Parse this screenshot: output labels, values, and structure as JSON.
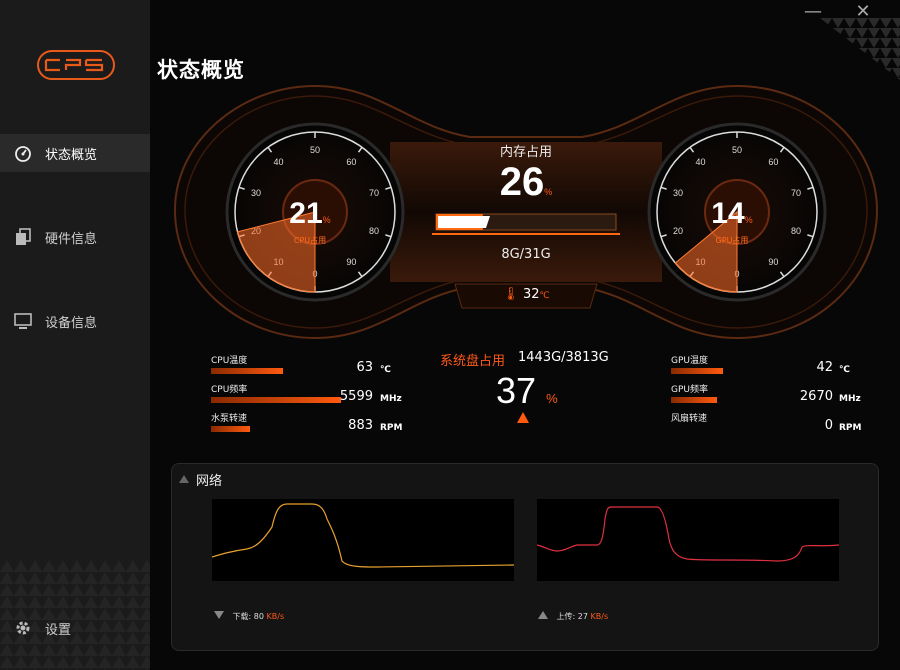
{
  "window": {
    "minimize": "—",
    "close": "✕"
  },
  "sidebar": {
    "items": [
      {
        "label": "状态概览",
        "icon": "speedometer-icon"
      },
      {
        "label": "硬件信息",
        "icon": "hardware-icon"
      },
      {
        "label": "设备信息",
        "icon": "monitor-icon"
      }
    ],
    "settings_label": "设置"
  },
  "page_title": "状态概览",
  "cpu_gauge": {
    "value": "21",
    "unit": "%",
    "label": "CPU占用",
    "ticks": [
      "0",
      "10",
      "20",
      "30",
      "40",
      "50",
      "60",
      "70",
      "80",
      "90"
    ],
    "level": 0.21
  },
  "gpu_gauge": {
    "value": "14",
    "unit": "%",
    "label": "GPU占用",
    "ticks": [
      "0",
      "10",
      "20",
      "30",
      "40",
      "50",
      "60",
      "70",
      "80",
      "90"
    ],
    "level": 0.14
  },
  "memory": {
    "label": "内存占用",
    "value": "26",
    "unit": "%",
    "usage": "8G/31G",
    "level": 0.26
  },
  "temperature": {
    "value": "32",
    "unit": "℃"
  },
  "disk": {
    "label": "系统盘占用",
    "usage": "1443G/3813G",
    "value": "37",
    "unit": "%"
  },
  "cpu_stats": [
    {
      "label": "CPU温度",
      "value": "63",
      "unit": "℃",
      "level": 0.55
    },
    {
      "label": "CPU频率",
      "value": "5599",
      "unit": "MHz",
      "level": 1.0
    },
    {
      "label": "水泵转速",
      "value": "883",
      "unit": "RPM",
      "level": 0.3
    }
  ],
  "gpu_stats": [
    {
      "label": "GPU温度",
      "value": "42",
      "unit": "℃",
      "level": 0.4
    },
    {
      "label": "GPU频率",
      "value": "2670",
      "unit": "MHz",
      "level": 0.35
    },
    {
      "label": "风扇转速",
      "value": "0",
      "unit": "RPM",
      "level": 0
    }
  ],
  "network": {
    "title": "网络",
    "download": {
      "label": "下载:",
      "value": "80",
      "unit": "KB/s"
    },
    "upload": {
      "label": "上传:",
      "value": "27",
      "unit": "KB/s"
    }
  },
  "colors": {
    "accent": "#ff5a10",
    "download_line": "#e8a030",
    "upload_line": "#e03040",
    "sidebar": "#1b1b1b"
  }
}
